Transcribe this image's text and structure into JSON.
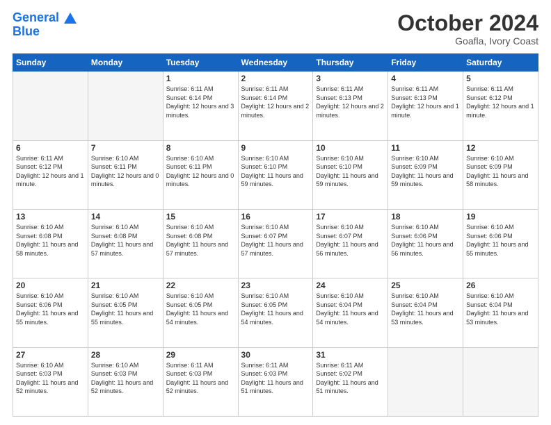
{
  "header": {
    "logo_line1": "General",
    "logo_line2": "Blue",
    "month": "October 2024",
    "location": "Goafla, Ivory Coast"
  },
  "days_of_week": [
    "Sunday",
    "Monday",
    "Tuesday",
    "Wednesday",
    "Thursday",
    "Friday",
    "Saturday"
  ],
  "weeks": [
    [
      {
        "day": "",
        "empty": true
      },
      {
        "day": "",
        "empty": true
      },
      {
        "day": "1",
        "sunrise": "Sunrise: 6:11 AM",
        "sunset": "Sunset: 6:14 PM",
        "daylight": "Daylight: 12 hours and 3 minutes."
      },
      {
        "day": "2",
        "sunrise": "Sunrise: 6:11 AM",
        "sunset": "Sunset: 6:14 PM",
        "daylight": "Daylight: 12 hours and 2 minutes."
      },
      {
        "day": "3",
        "sunrise": "Sunrise: 6:11 AM",
        "sunset": "Sunset: 6:13 PM",
        "daylight": "Daylight: 12 hours and 2 minutes."
      },
      {
        "day": "4",
        "sunrise": "Sunrise: 6:11 AM",
        "sunset": "Sunset: 6:13 PM",
        "daylight": "Daylight: 12 hours and 1 minute."
      },
      {
        "day": "5",
        "sunrise": "Sunrise: 6:11 AM",
        "sunset": "Sunset: 6:12 PM",
        "daylight": "Daylight: 12 hours and 1 minute."
      }
    ],
    [
      {
        "day": "6",
        "sunrise": "Sunrise: 6:11 AM",
        "sunset": "Sunset: 6:12 PM",
        "daylight": "Daylight: 12 hours and 1 minute."
      },
      {
        "day": "7",
        "sunrise": "Sunrise: 6:10 AM",
        "sunset": "Sunset: 6:11 PM",
        "daylight": "Daylight: 12 hours and 0 minutes."
      },
      {
        "day": "8",
        "sunrise": "Sunrise: 6:10 AM",
        "sunset": "Sunset: 6:11 PM",
        "daylight": "Daylight: 12 hours and 0 minutes."
      },
      {
        "day": "9",
        "sunrise": "Sunrise: 6:10 AM",
        "sunset": "Sunset: 6:10 PM",
        "daylight": "Daylight: 11 hours and 59 minutes."
      },
      {
        "day": "10",
        "sunrise": "Sunrise: 6:10 AM",
        "sunset": "Sunset: 6:10 PM",
        "daylight": "Daylight: 11 hours and 59 minutes."
      },
      {
        "day": "11",
        "sunrise": "Sunrise: 6:10 AM",
        "sunset": "Sunset: 6:09 PM",
        "daylight": "Daylight: 11 hours and 59 minutes."
      },
      {
        "day": "12",
        "sunrise": "Sunrise: 6:10 AM",
        "sunset": "Sunset: 6:09 PM",
        "daylight": "Daylight: 11 hours and 58 minutes."
      }
    ],
    [
      {
        "day": "13",
        "sunrise": "Sunrise: 6:10 AM",
        "sunset": "Sunset: 6:08 PM",
        "daylight": "Daylight: 11 hours and 58 minutes."
      },
      {
        "day": "14",
        "sunrise": "Sunrise: 6:10 AM",
        "sunset": "Sunset: 6:08 PM",
        "daylight": "Daylight: 11 hours and 57 minutes."
      },
      {
        "day": "15",
        "sunrise": "Sunrise: 6:10 AM",
        "sunset": "Sunset: 6:08 PM",
        "daylight": "Daylight: 11 hours and 57 minutes."
      },
      {
        "day": "16",
        "sunrise": "Sunrise: 6:10 AM",
        "sunset": "Sunset: 6:07 PM",
        "daylight": "Daylight: 11 hours and 57 minutes."
      },
      {
        "day": "17",
        "sunrise": "Sunrise: 6:10 AM",
        "sunset": "Sunset: 6:07 PM",
        "daylight": "Daylight: 11 hours and 56 minutes."
      },
      {
        "day": "18",
        "sunrise": "Sunrise: 6:10 AM",
        "sunset": "Sunset: 6:06 PM",
        "daylight": "Daylight: 11 hours and 56 minutes."
      },
      {
        "day": "19",
        "sunrise": "Sunrise: 6:10 AM",
        "sunset": "Sunset: 6:06 PM",
        "daylight": "Daylight: 11 hours and 55 minutes."
      }
    ],
    [
      {
        "day": "20",
        "sunrise": "Sunrise: 6:10 AM",
        "sunset": "Sunset: 6:06 PM",
        "daylight": "Daylight: 11 hours and 55 minutes."
      },
      {
        "day": "21",
        "sunrise": "Sunrise: 6:10 AM",
        "sunset": "Sunset: 6:05 PM",
        "daylight": "Daylight: 11 hours and 55 minutes."
      },
      {
        "day": "22",
        "sunrise": "Sunrise: 6:10 AM",
        "sunset": "Sunset: 6:05 PM",
        "daylight": "Daylight: 11 hours and 54 minutes."
      },
      {
        "day": "23",
        "sunrise": "Sunrise: 6:10 AM",
        "sunset": "Sunset: 6:05 PM",
        "daylight": "Daylight: 11 hours and 54 minutes."
      },
      {
        "day": "24",
        "sunrise": "Sunrise: 6:10 AM",
        "sunset": "Sunset: 6:04 PM",
        "daylight": "Daylight: 11 hours and 54 minutes."
      },
      {
        "day": "25",
        "sunrise": "Sunrise: 6:10 AM",
        "sunset": "Sunset: 6:04 PM",
        "daylight": "Daylight: 11 hours and 53 minutes."
      },
      {
        "day": "26",
        "sunrise": "Sunrise: 6:10 AM",
        "sunset": "Sunset: 6:04 PM",
        "daylight": "Daylight: 11 hours and 53 minutes."
      }
    ],
    [
      {
        "day": "27",
        "sunrise": "Sunrise: 6:10 AM",
        "sunset": "Sunset: 6:03 PM",
        "daylight": "Daylight: 11 hours and 52 minutes."
      },
      {
        "day": "28",
        "sunrise": "Sunrise: 6:10 AM",
        "sunset": "Sunset: 6:03 PM",
        "daylight": "Daylight: 11 hours and 52 minutes."
      },
      {
        "day": "29",
        "sunrise": "Sunrise: 6:11 AM",
        "sunset": "Sunset: 6:03 PM",
        "daylight": "Daylight: 11 hours and 52 minutes."
      },
      {
        "day": "30",
        "sunrise": "Sunrise: 6:11 AM",
        "sunset": "Sunset: 6:03 PM",
        "daylight": "Daylight: 11 hours and 51 minutes."
      },
      {
        "day": "31",
        "sunrise": "Sunrise: 6:11 AM",
        "sunset": "Sunset: 6:02 PM",
        "daylight": "Daylight: 11 hours and 51 minutes."
      },
      {
        "day": "",
        "empty": true
      },
      {
        "day": "",
        "empty": true
      }
    ]
  ]
}
